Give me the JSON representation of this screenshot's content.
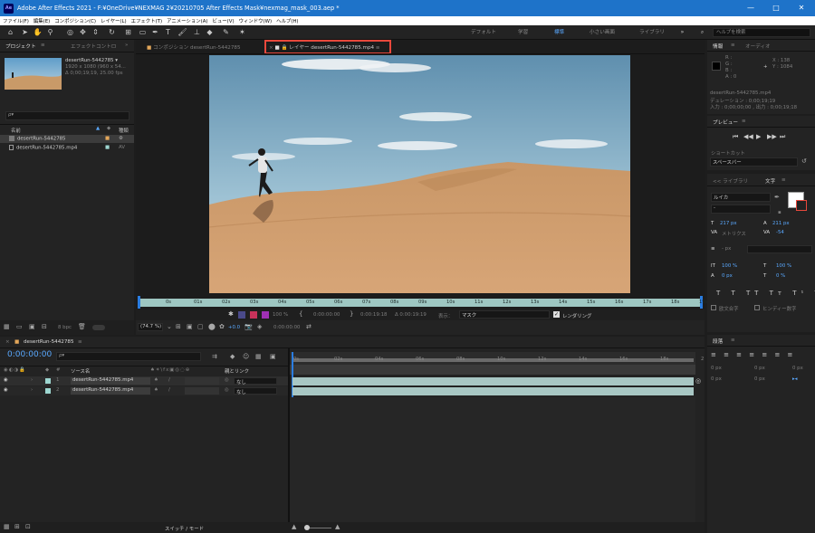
{
  "titlebar": {
    "title": "Adobe After Effects 2021 - F:¥OneDrive¥NEXMAG 2¥20210705 After Effects Mask¥nexmag_mask_003.aep *",
    "logo": "Ae"
  },
  "menu": [
    "ファイル(F)",
    "編集(E)",
    "コンポジション(C)",
    "レイヤー(L)",
    "エフェクト(T)",
    "アニメーション(A)",
    "ビュー(V)",
    "ウィンドウ(W)",
    "ヘルプ(H)"
  ],
  "workspaces": [
    "デフォルト",
    "学習",
    "標準",
    "小さい画面",
    "ライブラリ"
  ],
  "help_search": "ヘルプを検索",
  "project": {
    "tab": "プロジェクト",
    "tab2": "エフェクトコントロ",
    "thumb_name": "desertRun-5442785 ▾",
    "thumb_info1": "1920 x 1080 (960 x 54...",
    "thumb_info2": "Δ 0;00;19;19, 25.00 fps",
    "search_placeholder": "ρ▾",
    "col_name": "名前",
    "col_type": "種類",
    "items": [
      {
        "name": "desertRun-5442785",
        "type": "⚙"
      },
      {
        "name": "desertRun-5442785.mp4",
        "type": "AV"
      }
    ],
    "bpc": "8 bpc"
  },
  "viewer": {
    "comp_tab": "コンポジション desertRun-5442785",
    "layer_tab": "レイヤー desertRun-5442785.mp4",
    "ruler_ticks": [
      "0s",
      "01s",
      "02s",
      "03s",
      "04s",
      "05s",
      "06s",
      "07s",
      "08s",
      "09s",
      "10s",
      "11s",
      "12s",
      "13s",
      "14s",
      "15s",
      "16s",
      "17s",
      "18s",
      "19s"
    ],
    "t_in": "0:00:00:00",
    "t_out": "0:00:19:18",
    "t_dur": "Δ 0:00:19:19",
    "display_label": "表示：",
    "display_value": "マスク",
    "render_label": "レンダリング",
    "zoom": "(74.7 %)",
    "offset": "+0.0",
    "timecode": "0:00:00:00",
    "pct": "100 %"
  },
  "info": {
    "tab": "情報",
    "tab2": "オーディオ",
    "r": "R :",
    "g": "G :",
    "b": "B :",
    "a": "A : 0",
    "x": "X : 138",
    "y": "Y : 1084",
    "line1": "desertRun-5442785.mp4",
    "line2": "デュレーション : 0;00;19;19",
    "line3": "入力 : 0;00;00;00 , 出力 : 0;00;19;18"
  },
  "preview": {
    "tab": "プレビュー",
    "shortcut_label": "ショートカット",
    "shortcut_value": "スペースバー"
  },
  "char": {
    "tab1": "<< ライブラリ",
    "tab2": "文字",
    "font": "ルイカ",
    "style": "-",
    "size": "217 px",
    "lead": "211 px",
    "kern": "メトリクス",
    "track": "-54",
    "stroke": "- px",
    "vscale": "100 %",
    "hscale": "100 %",
    "baseline": "0 px",
    "tsume": "0 %",
    "ligature": "欧文合字",
    "hindi": "ヒンディー数字"
  },
  "para": {
    "tab": "段落",
    "v1": "0 px",
    "v2": "0 px",
    "v3": "0 px",
    "v4": "0 px",
    "v5": "0 px"
  },
  "timeline": {
    "tab": "desertRun-5442785",
    "timecode": "0:00:00:00",
    "search": "ρ▾",
    "col_src": "ソース名",
    "col_parent": "親とリンク",
    "footer_label": "スイッチ / モード",
    "ticks": [
      "0s",
      "02s",
      "04s",
      "06s",
      "08s",
      "10s",
      "12s",
      "14s",
      "16s",
      "18s",
      "2"
    ],
    "layers": [
      {
        "num": "1",
        "name": "desertRun-5442785.mp4",
        "parent": "なし"
      },
      {
        "num": "2",
        "name": "desertRun-5442785.mp4",
        "parent": "なし"
      }
    ]
  },
  "colors": {
    "title_blue": "#1e73c9",
    "accent": "#5aa9ff",
    "highlight_red": "#e8483c",
    "ruler": "#9ec7c2",
    "track": "#a8c7c4"
  }
}
